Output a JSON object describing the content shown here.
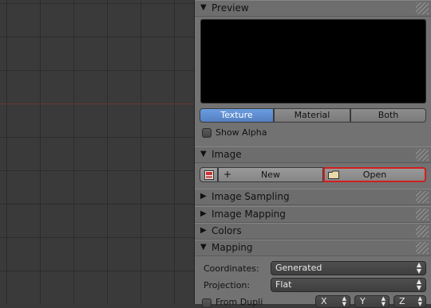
{
  "panels": {
    "preview": {
      "title": "Preview",
      "tabs": [
        {
          "label": "Texture",
          "active": true
        },
        {
          "label": "Material",
          "active": false
        },
        {
          "label": "Both",
          "active": false
        }
      ],
      "show_alpha_label": "Show Alpha"
    },
    "image": {
      "title": "Image",
      "new_label": "New",
      "open_label": "Open"
    },
    "image_sampling": {
      "title": "Image Sampling"
    },
    "image_mapping": {
      "title": "Image Mapping"
    },
    "colors": {
      "title": "Colors"
    },
    "mapping": {
      "title": "Mapping",
      "coordinates_label": "Coordinates:",
      "coordinates_value": "Generated",
      "projection_label": "Projection:",
      "projection_value": "Flat",
      "from_dupli_label": "From Dupli",
      "axes": [
        "X",
        "Y",
        "Z"
      ]
    }
  },
  "colors": {
    "active_tab": "#5e8ed6",
    "highlight_outline": "#d11f1f",
    "panel_bg": "#727272",
    "viewport_bg": "#3a3a3a"
  }
}
